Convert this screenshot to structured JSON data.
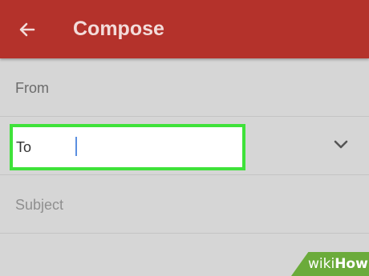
{
  "appbar": {
    "title": "Compose",
    "back_icon": "arrow-left-icon",
    "color": "#b4322b"
  },
  "form": {
    "from_label": "From",
    "to_label": "To",
    "to_value": "",
    "subject_placeholder": "Subject",
    "expand_icon": "chevron-down-icon",
    "highlight_color": "#3fe23a"
  },
  "watermark": {
    "prefix": "wiki",
    "suffix": "How"
  }
}
